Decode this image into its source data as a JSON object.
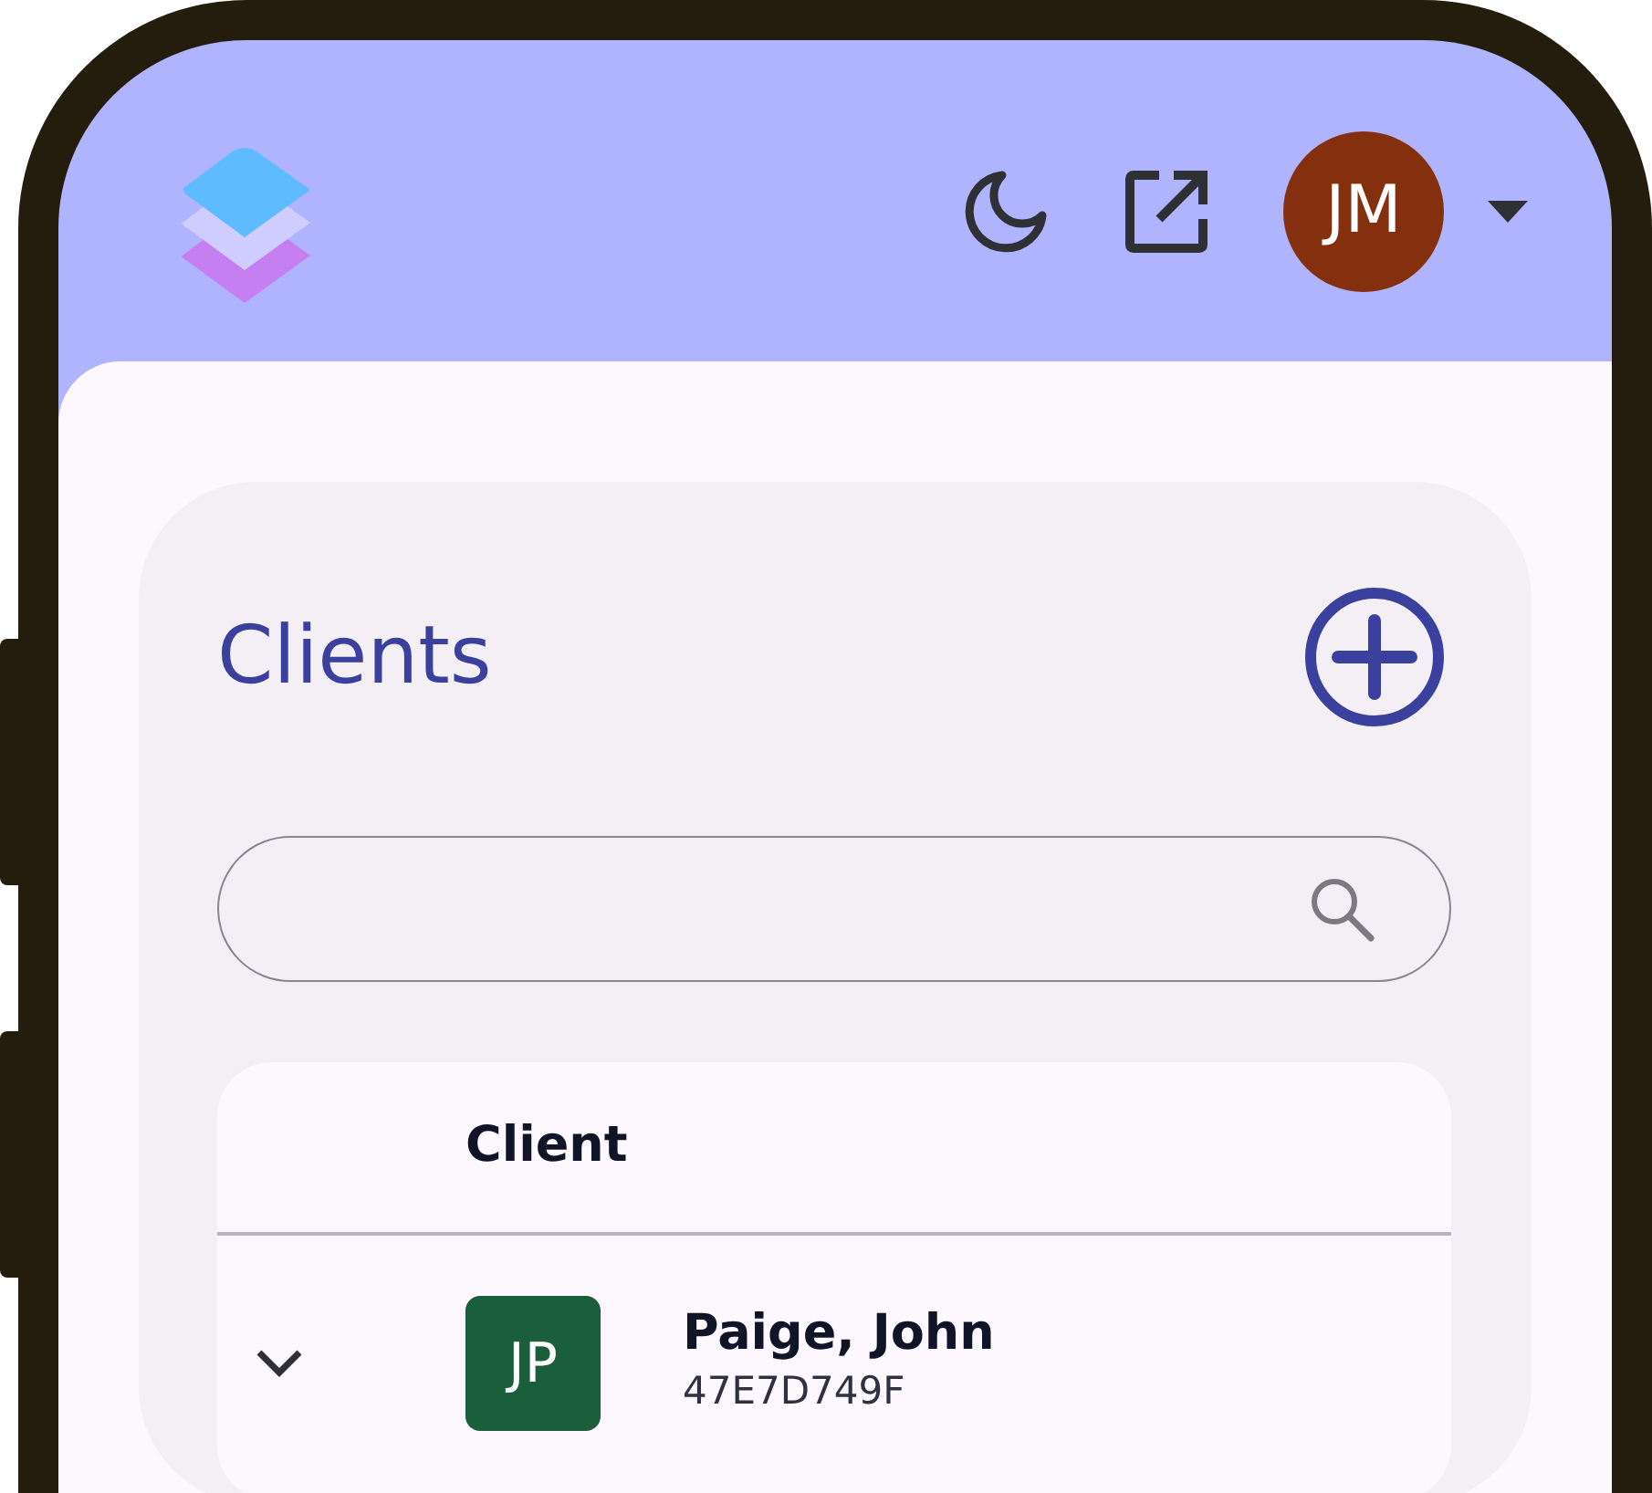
{
  "header": {
    "user_initials": "JM"
  },
  "page": {
    "title": "Clients"
  },
  "table": {
    "columns": [
      "Client"
    ],
    "rows": [
      {
        "initials": "JP",
        "name": "Paige, John",
        "id": "47E7D749F",
        "expanded": false
      }
    ]
  }
}
